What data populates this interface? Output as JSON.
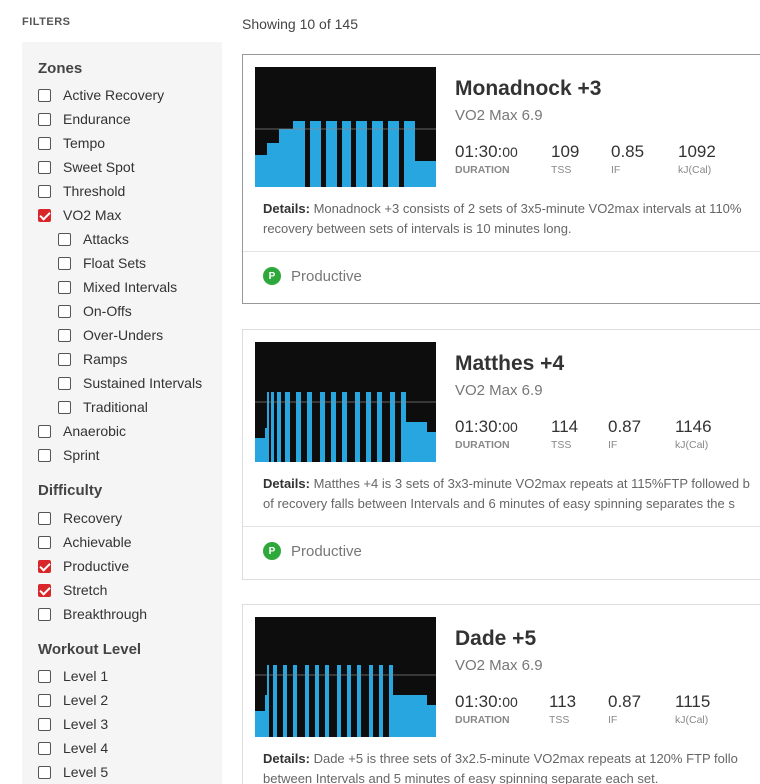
{
  "filters_heading": "FILTERS",
  "results_count": "Showing 10 of 145",
  "colors": {
    "accent": "#d9262b",
    "workout_fill": "#27a6e0",
    "thumb_bg": "#0d0d0d",
    "productive_badge": "#2ea83a"
  },
  "zones": {
    "title": "Zones",
    "items": [
      {
        "label": "Active Recovery",
        "checked": false
      },
      {
        "label": "Endurance",
        "checked": false
      },
      {
        "label": "Tempo",
        "checked": false
      },
      {
        "label": "Sweet Spot",
        "checked": false
      },
      {
        "label": "Threshold",
        "checked": false
      },
      {
        "label": "VO2 Max",
        "checked": true
      },
      {
        "label": "Attacks",
        "checked": false
      },
      {
        "label": "Float Sets",
        "checked": false
      },
      {
        "label": "Mixed Intervals",
        "checked": false
      },
      {
        "label": "On-Offs",
        "checked": false
      },
      {
        "label": "Over-Unders",
        "checked": false
      },
      {
        "label": "Ramps",
        "checked": false
      },
      {
        "label": "Sustained Intervals",
        "checked": false
      },
      {
        "label": "Traditional",
        "checked": false
      },
      {
        "label": "Anaerobic",
        "checked": false
      },
      {
        "label": "Sprint",
        "checked": false
      }
    ]
  },
  "difficulty": {
    "title": "Difficulty",
    "items": [
      {
        "label": "Recovery",
        "checked": false
      },
      {
        "label": "Achievable",
        "checked": false
      },
      {
        "label": "Productive",
        "checked": true
      },
      {
        "label": "Stretch",
        "checked": true
      },
      {
        "label": "Breakthrough",
        "checked": false
      }
    ]
  },
  "workout_level": {
    "title": "Workout Level",
    "items": [
      {
        "label": "Level 1",
        "checked": false
      },
      {
        "label": "Level 2",
        "checked": false
      },
      {
        "label": "Level 3",
        "checked": false
      },
      {
        "label": "Level 4",
        "checked": false
      },
      {
        "label": "Level 5",
        "checked": false
      }
    ]
  },
  "workouts": [
    {
      "name": "Monadnock +3",
      "subtitle": "VO2 Max 6.9",
      "duration": "01:30:",
      "duration_small": "00",
      "duration_label": "DURATION",
      "tss": "109",
      "tss_label": "TSS",
      "if": "0.85",
      "if_label": "IF",
      "kj": "1092",
      "kj_label": "kJ(Cal)",
      "details_label": "Details:",
      "details_line1": " Monadnock +3 consists of 2 sets of 3x5-minute VO2max intervals at 110%",
      "details_line2": "recovery between sets of intervals is 10 minutes long.",
      "badge_letter": "P",
      "badge": "Productive"
    },
    {
      "name": "Matthes +4",
      "subtitle": "VO2 Max 6.9",
      "duration": "01:30:",
      "duration_small": "00",
      "duration_label": "DURATION",
      "tss": "114",
      "tss_label": "TSS",
      "if": "0.87",
      "if_label": "IF",
      "kj": "1146",
      "kj_label": "kJ(Cal)",
      "details_label": "Details:",
      "details_line1": " Matthes +4 is 3 sets of 3x3-minute VO2max repeats at 115%FTP followed b",
      "details_line2": "of recovery falls between Intervals and 6 minutes of easy spinning separates the s",
      "badge_letter": "P",
      "badge": "Productive"
    },
    {
      "name": "Dade +5",
      "subtitle": "VO2 Max 6.9",
      "duration": "01:30:",
      "duration_small": "00",
      "duration_label": "DURATION",
      "tss": "113",
      "tss_label": "TSS",
      "if": "0.87",
      "if_label": "IF",
      "kj": "1115",
      "kj_label": "kJ(Cal)",
      "details_label": "Details:",
      "details_line1": " Dade +5 is three sets of 3x2.5-minute VO2max repeats at 120% FTP follo",
      "details_line2": "between Intervals and 5 minutes of easy spinning separate each set."
    }
  ]
}
